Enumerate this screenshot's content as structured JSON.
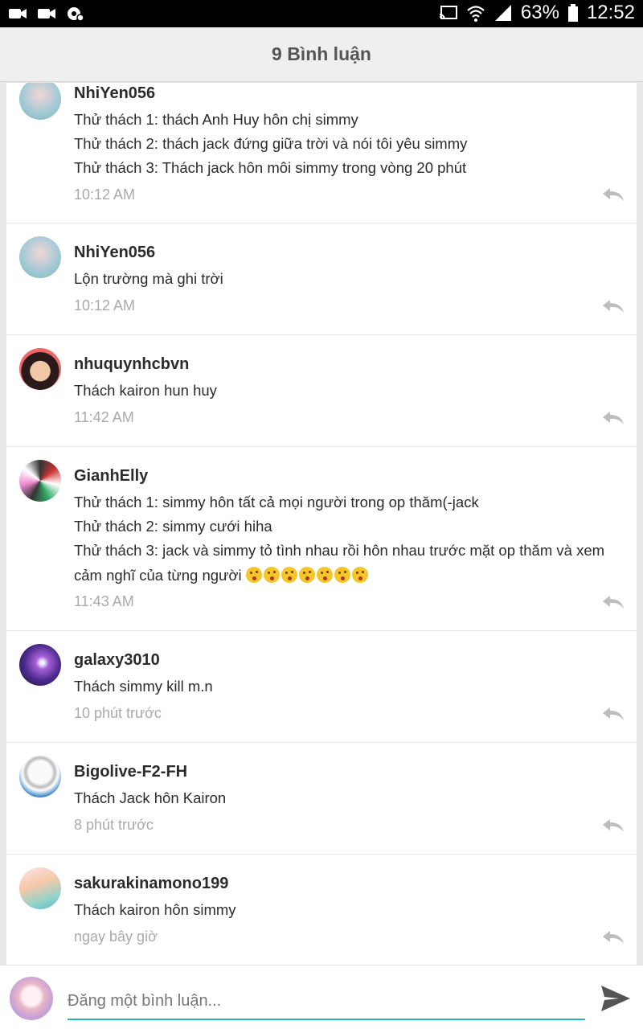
{
  "status_bar": {
    "battery": "63%",
    "time": "12:52",
    "icons": [
      "video-camera-icon",
      "video-camera-icon",
      "settings-icon",
      "cast-icon",
      "wifi-icon",
      "signal-icon",
      "battery-icon"
    ]
  },
  "header": {
    "title": "9 Bình luận"
  },
  "comments": [
    {
      "username": "NhiYen056",
      "lines": [
        "Thử thách 1: thách Anh Huy hôn chị simmy",
        "Thử thách 2: thách jack đứng giữa trời và nói tôi yêu simmy",
        "Thử thách 3: Thách jack hôn môi simmy trong vòng 20 phút"
      ],
      "time": "10:12 AM"
    },
    {
      "username": "NhiYen056",
      "lines": [
        "Lộn trường mà ghi trời"
      ],
      "time": "10:12 AM"
    },
    {
      "username": "nhuquynhcbvn",
      "lines": [
        "Thách kairon hun huy"
      ],
      "time": "11:42 AM"
    },
    {
      "username": "GianhElly",
      "lines": [
        "Thử thách 1: simmy hôn tất cả mọi người trong op thăm(-jack",
        "Thử thách 2: simmy cưới hiha",
        "Thử thách 3: jack và simmy tỏ tình nhau rồi hôn nhau trước mặt op thăm và xem",
        "cảm nghĩ của từng người"
      ],
      "emoji_count": 7,
      "time": "11:43 AM"
    },
    {
      "username": "galaxy3010",
      "lines": [
        "Thách simmy kill m.n"
      ],
      "time": "10 phút trước"
    },
    {
      "username": "Bigolive-F2-FH",
      "lines": [
        "Thách Jack hôn Kairon"
      ],
      "time": "8 phút trước"
    },
    {
      "username": "sakurakinamono199",
      "lines": [
        "Thách kairon hôn simmy"
      ],
      "time": "ngay bây giờ"
    }
  ],
  "composer": {
    "placeholder": "Đăng một bình luận..."
  },
  "colors": {
    "accent": "#2bb5b8",
    "time_text": "#aaaaaa",
    "icon_gray": "#bdbdbd"
  }
}
